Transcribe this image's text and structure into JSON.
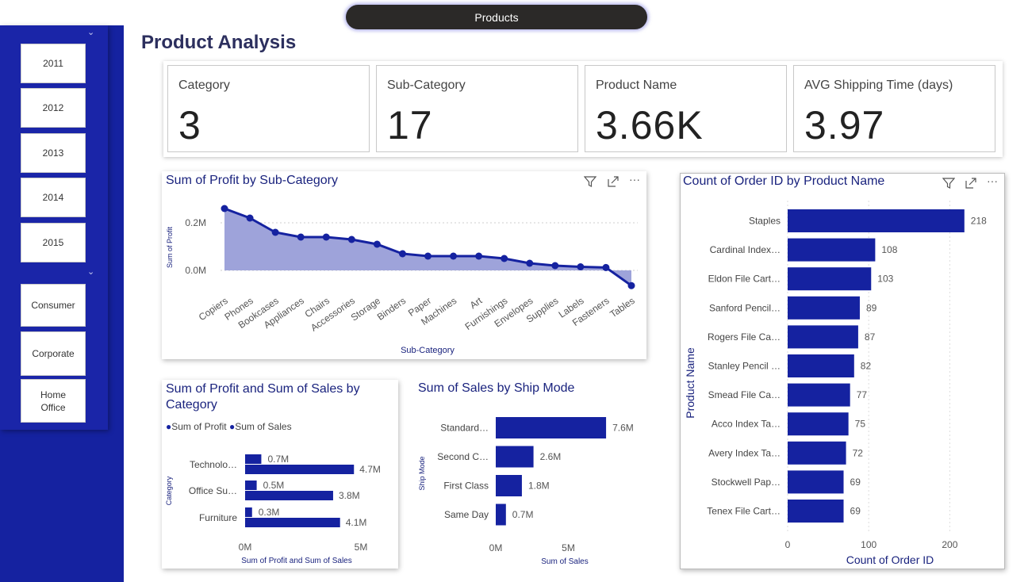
{
  "page": {
    "tab_label": "Products",
    "title": "Product Analysis"
  },
  "slicers": {
    "years": [
      "2011",
      "2012",
      "2013",
      "2014",
      "2015"
    ],
    "segments": [
      "Consumer",
      "Corporate",
      "Home Office"
    ]
  },
  "kpis": [
    {
      "label": "Category",
      "value": "3"
    },
    {
      "label": "Sub-Category",
      "value": "17"
    },
    {
      "label": "Product Name",
      "value": "3.66K"
    },
    {
      "label": "AVG Shipping Time (days)",
      "value": "3.97"
    }
  ],
  "icons": {
    "filter": "filter-icon",
    "focus": "focus-mode-icon",
    "more": "more-options-icon"
  },
  "colors": {
    "accent": "#1522a0",
    "area_fill": "#9ea3da",
    "bar": "#1522a0"
  },
  "charts": {
    "profit_by_subcategory": {
      "title": "Sum of Profit by Sub-Category",
      "chart_data": {
        "type": "area",
        "xlabel": "Sub-Category",
        "ylabel": "Sum of Profit",
        "yticks": [
          "0.2M",
          "0.0M"
        ],
        "categories": [
          "Copiers",
          "Phones",
          "Bookcases",
          "Appliances",
          "Chairs",
          "Accessories",
          "Storage",
          "Binders",
          "Paper",
          "Machines",
          "Art",
          "Furnishings",
          "Envelopes",
          "Supplies",
          "Labels",
          "Fasteners",
          "Tables"
        ],
        "values": [
          0.26,
          0.22,
          0.16,
          0.14,
          0.14,
          0.13,
          0.11,
          0.07,
          0.06,
          0.06,
          0.06,
          0.05,
          0.03,
          0.02,
          0.015,
          0.012,
          -0.064
        ],
        "ylim": [
          -0.08,
          0.3
        ]
      }
    },
    "order_count_by_product": {
      "title": "Count of Order ID by Product Name",
      "chart_data": {
        "type": "bar",
        "orientation": "horizontal",
        "xlabel": "Count of Order ID",
        "ylabel": "Product Name",
        "categories": [
          "Staples",
          "Cardinal Index…",
          "Eldon File Cart…",
          "Sanford Pencil…",
          "Rogers File Ca…",
          "Stanley Pencil …",
          "Smead File Ca…",
          "Acco Index Ta…",
          "Avery Index Ta…",
          "Stockwell Pap…",
          "Tenex File Cart…"
        ],
        "values": [
          218,
          108,
          103,
          89,
          87,
          82,
          77,
          75,
          72,
          69,
          69
        ],
        "xticks": [
          "0",
          "100",
          "200"
        ],
        "xlim": [
          0,
          260
        ]
      }
    },
    "profit_sales_by_category": {
      "title": "Sum of Profit and Sum of Sales by Category",
      "legend": [
        "Sum of Profit",
        "Sum of Sales"
      ],
      "chart_data": {
        "type": "bar",
        "orientation": "horizontal",
        "xlabel": "Sum of Profit and Sum of Sales",
        "ylabel": "Category",
        "categories": [
          "Technolo…",
          "Office Su…",
          "Furniture"
        ],
        "series": [
          {
            "name": "Sum of Profit",
            "values": [
              0.7,
              0.5,
              0.3
            ],
            "labels": [
              "0.7M",
              "0.5M",
              "0.3M"
            ]
          },
          {
            "name": "Sum of Sales",
            "values": [
              4.7,
              3.8,
              4.1
            ],
            "labels": [
              "4.7M",
              "3.8M",
              "4.1M"
            ]
          }
        ],
        "xticks": [
          "0M",
          "5M"
        ],
        "xlim": [
          0,
          5
        ]
      }
    },
    "sales_by_shipmode": {
      "title": "Sum of Sales by Ship Mode",
      "chart_data": {
        "type": "bar",
        "orientation": "horizontal",
        "xlabel": "Sum of Sales",
        "ylabel": "Ship Mode",
        "categories": [
          "Standard…",
          "Second C…",
          "First Class",
          "Same Day"
        ],
        "values": [
          7.6,
          2.6,
          1.8,
          0.7
        ],
        "labels": [
          "7.6M",
          "2.6M",
          "1.8M",
          "0.7M"
        ],
        "xticks": [
          "0M",
          "5M"
        ],
        "xlim": [
          0,
          5
        ]
      }
    }
  }
}
